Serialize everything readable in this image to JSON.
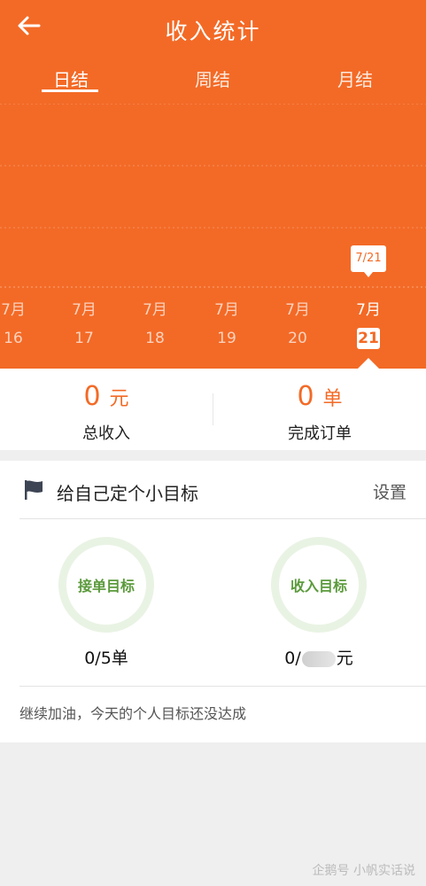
{
  "header": {
    "title": "收入统计"
  },
  "tabs": [
    {
      "label": "日结",
      "active": true
    },
    {
      "label": "周结",
      "active": false
    },
    {
      "label": "月结",
      "active": false
    }
  ],
  "chart": {
    "tooltip": "7/21",
    "days": [
      {
        "month": "7月",
        "day": "16"
      },
      {
        "month": "7月",
        "day": "17"
      },
      {
        "month": "7月",
        "day": "18"
      },
      {
        "month": "7月",
        "day": "19"
      },
      {
        "month": "7月",
        "day": "20"
      },
      {
        "month": "7月",
        "day": "21",
        "selected": true
      }
    ]
  },
  "summary": {
    "income": {
      "value": "0",
      "unit": "元",
      "label": "总收入"
    },
    "orders": {
      "value": "0",
      "unit": "单",
      "label": "完成订单"
    }
  },
  "goal": {
    "title": "给自己定个小目标",
    "set_label": "设置",
    "order_goal": {
      "label": "接单目标",
      "value": "0/5单"
    },
    "income_goal": {
      "label": "收入目标",
      "prefix": "0/",
      "suffix": "元"
    },
    "footer": "继续加油，今天的个人目标还没达成"
  },
  "watermark": "企鹅号 小帆实话说",
  "colors": {
    "accent": "#f36a26",
    "goal_green": "#5b9a3c",
    "ring": "#e9f3e4"
  }
}
